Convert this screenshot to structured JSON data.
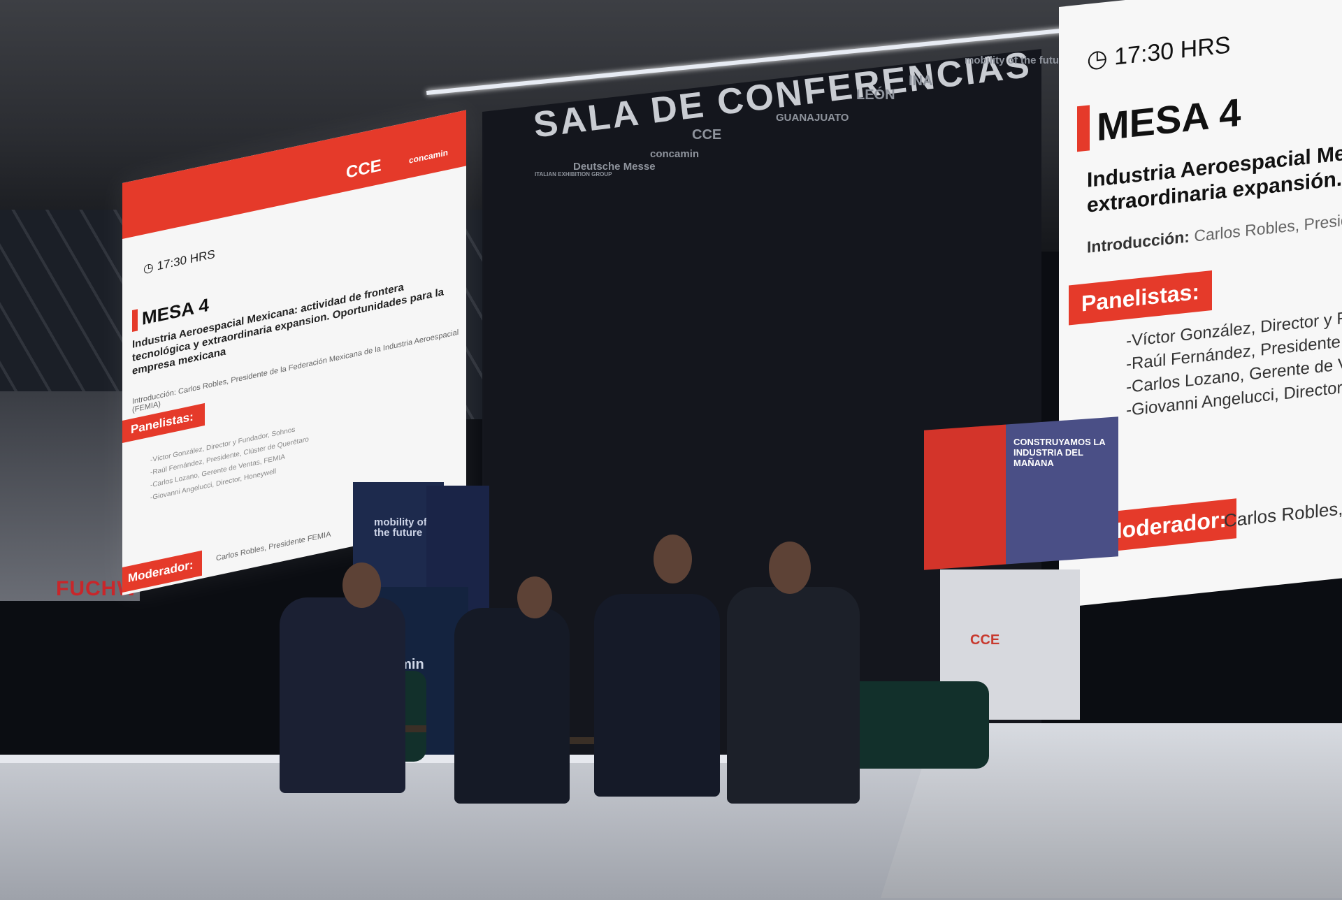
{
  "backdrop": {
    "title": "SALA DE CONFERENCIAS",
    "sponsors": [
      "Deutsche Messe",
      "concamin",
      "CCE",
      "GUANAJUATO",
      "LEÓN",
      "mobility of the future",
      "INA",
      "ITALIAN EXHIBITION GROUP"
    ]
  },
  "left_screen": {
    "logos": [
      "CCE",
      "concamin"
    ],
    "time": "17:30 HRS",
    "mesa": "MESA 4",
    "title": "Industria Aeroespacial Mexicana: actividad de frontera tecnológica y extraordinaria expansion. Oportunidades para la empresa mexicana",
    "intro": "Introducción: Carlos Robles, Presidente de la Federación Mexicana de la Industria Aeroespacial (FEMIA)",
    "panelists_label": "Panelistas:",
    "panelists": [
      "-Víctor González, Director y Fundador, Sohnos",
      "-Raúl Fernández, Presidente, Clúster de Querétaro",
      "-Carlos Lozano, Gerente de Ventas, FEMIA",
      "-Giovanni Angelucci, Director, Honeywell"
    ],
    "moderator_label": "Moderador:",
    "moderator": "Carlos Robles, Presidente FEMIA"
  },
  "right_screen": {
    "time": "17:30 HRS",
    "mesa": "MESA 4",
    "title_line1": "Industria Aeroespacial Mexi",
    "title_line2": "extraordinaria expansión. O",
    "intro_label": "Introducción:",
    "intro": "Carlos Robles, President",
    "panelists_label": "Panelistas:",
    "panelists": [
      "-Víctor González, Director y Fun",
      "-Raúl Fernández, Presidente, O",
      "-Carlos Lozano, Gerente de Ver",
      "-Giovanni Angelucci, Director, H"
    ],
    "moderator_label": "Moderador:",
    "moderator": "Carlos Robles, P"
  },
  "pedestal": {
    "headline": "CONSTRUYAMOS LA INDUSTRIA DEL MAÑANA",
    "logo": "CCE"
  },
  "pillar": {
    "brand": "mobility of the future",
    "side_text": "amin"
  },
  "left_sign": "FUCHW",
  "colors": {
    "accent_red": "#e53a2a",
    "backdrop": "#14161d",
    "stage": "#c6c9d0"
  }
}
